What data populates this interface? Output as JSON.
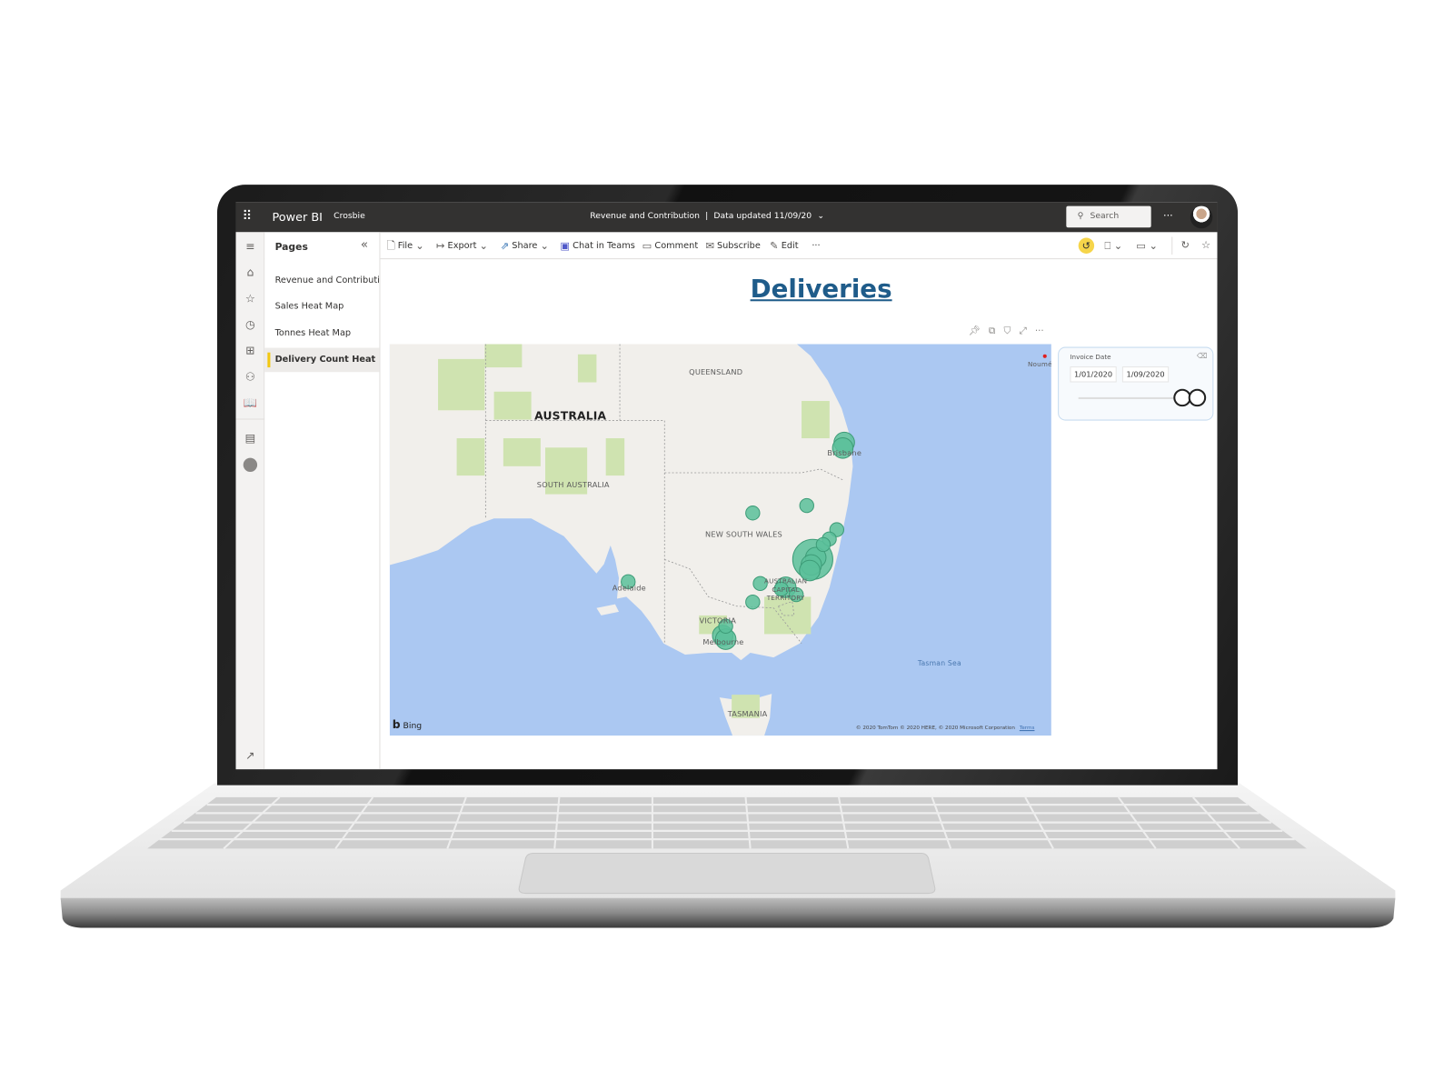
{
  "app": {
    "name": "Power BI",
    "workspace": "Crosbie",
    "report_title": "Revenue and Contribution",
    "data_updated": "Data updated 11/09/20",
    "search_placeholder": "Search",
    "more": "···"
  },
  "toolbar": {
    "file": "File",
    "export": "Export",
    "share": "Share",
    "chat": "Chat in Teams",
    "comment": "Comment",
    "subscribe": "Subscribe",
    "edit": "Edit",
    "more": "···"
  },
  "pages": {
    "header": "Pages",
    "items": [
      {
        "label": "Revenue and Contributi..."
      },
      {
        "label": "Sales Heat Map"
      },
      {
        "label": "Tonnes Heat Map"
      },
      {
        "label": "Delivery Count Heat ...",
        "selected": true
      }
    ]
  },
  "report": {
    "title": "Deliveries"
  },
  "map": {
    "provider": "Bing",
    "copyright": "© 2020 TomTom © 2020 HERE, © 2020 Microsoft Corporation",
    "terms": "Terms",
    "bounds": {
      "lon_min": 122.7,
      "lon_max": 166.8,
      "lat_max": -21.9,
      "lat_min": -43.0
    },
    "bubble_color": "#5bbf9a",
    "labels": {
      "country": "AUSTRALIA",
      "qld": "QUEENSLAND",
      "sa": "SOUTH AUSTRALIA",
      "nsw": "NEW SOUTH WALES",
      "act": "AUSTRALIAN CAPITAL TERRITORY",
      "vic": "VICTORIA",
      "tas": "TASMANIA",
      "adelaide": "Adelaide",
      "melbourne": "Melbourne",
      "brisbane": "Brisbane",
      "sea": "Tasman Sea",
      "noumea": "Nouméa"
    },
    "points": [
      {
        "lon": 153.0,
        "lat": -27.2,
        "size": 2
      },
      {
        "lon": 152.9,
        "lat": -27.5,
        "size": 2
      },
      {
        "lon": 146.9,
        "lat": -31.0,
        "size": 1
      },
      {
        "lon": 150.5,
        "lat": -30.6,
        "size": 1
      },
      {
        "lon": 152.5,
        "lat": -31.9,
        "size": 1
      },
      {
        "lon": 152.0,
        "lat": -32.4,
        "size": 1
      },
      {
        "lon": 151.6,
        "lat": -32.7,
        "size": 1
      },
      {
        "lon": 150.9,
        "lat": -33.5,
        "size": 5
      },
      {
        "lon": 151.1,
        "lat": -33.4,
        "size": 2
      },
      {
        "lon": 150.8,
        "lat": -33.8,
        "size": 2
      },
      {
        "lon": 150.7,
        "lat": -34.1,
        "size": 2
      },
      {
        "lon": 147.4,
        "lat": -34.8,
        "size": 1
      },
      {
        "lon": 149.1,
        "lat": -35.0,
        "size": 2
      },
      {
        "lon": 148.8,
        "lat": -35.1,
        "size": 1
      },
      {
        "lon": 149.8,
        "lat": -35.4,
        "size": 1
      },
      {
        "lon": 146.9,
        "lat": -35.8,
        "size": 1
      },
      {
        "lon": 138.6,
        "lat": -34.7,
        "size": 1
      },
      {
        "lon": 144.9,
        "lat": -37.6,
        "size": 2
      },
      {
        "lon": 145.1,
        "lat": -37.8,
        "size": 2
      },
      {
        "lon": 145.1,
        "lat": -37.1,
        "size": 1
      }
    ]
  },
  "slicer": {
    "title": "Invoice Date",
    "start": "1/01/2020",
    "end": "1/09/2020",
    "range_fraction": [
      0.93,
      1.0
    ]
  },
  "colors": {
    "topbar": "#333231",
    "accent": "#f2c811",
    "title": "#1f5c8a",
    "ocean": "#abc8f2",
    "land": "#f1efeb"
  }
}
